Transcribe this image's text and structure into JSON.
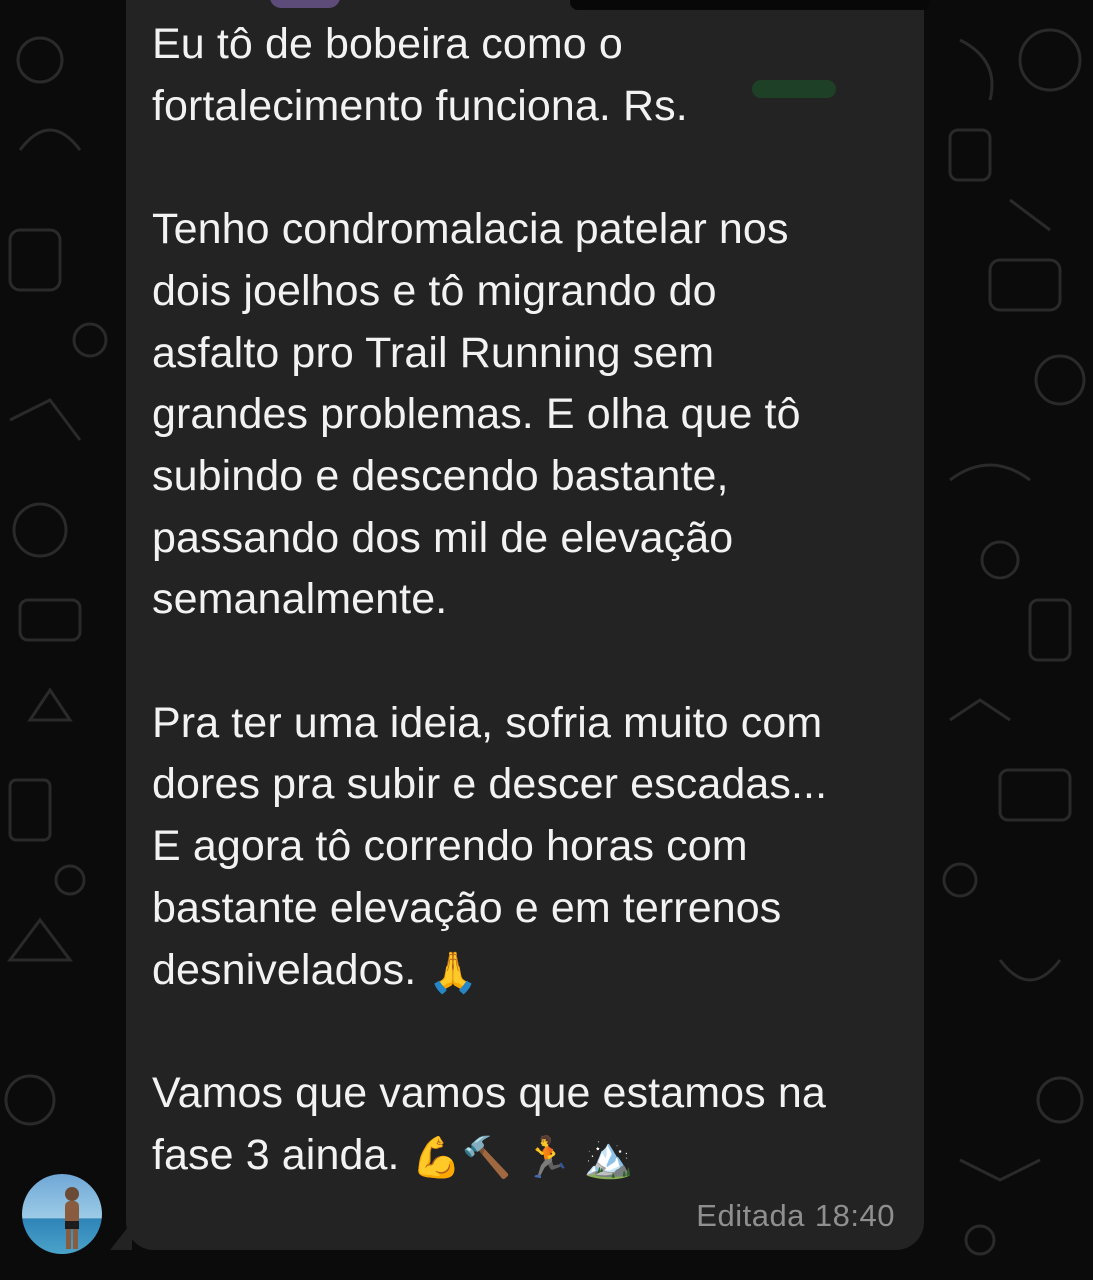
{
  "chat": {
    "message": {
      "paragraph_1": "Eu tô de bobeira como o\nfortalecimento funciona. Rs.",
      "paragraph_2": "Tenho condromalacia patelar nos\ndois joelhos e tô migrando do\nasfalto pro Trail Running sem\ngrandes problemas. E olha que tô\nsubindo e descendo bastante,\npassando dos mil de elevação\nsemanalmente.",
      "paragraph_3": "Pra ter uma ideia, sofria muito com\ndores pra subir e descer escadas...\nE agora tô correndo horas com\nbastante elevação e em terrenos\ndesnivelados.",
      "paragraph_3_emoji": "🙏",
      "paragraph_4": "Vamos que vamos que estamos na\nfase 3 ainda.",
      "paragraph_4_emoji": "💪🔨 🏃 🏔️",
      "status": "Editada",
      "time": "18:40"
    },
    "colors": {
      "background": "#0b0b0b",
      "bubble": "#232323",
      "text": "#f2f2f2",
      "meta": "#8f8f8f",
      "sender_accent": "#8e6fc2"
    },
    "avatar": {
      "icon": "person-on-beach-avatar"
    }
  }
}
